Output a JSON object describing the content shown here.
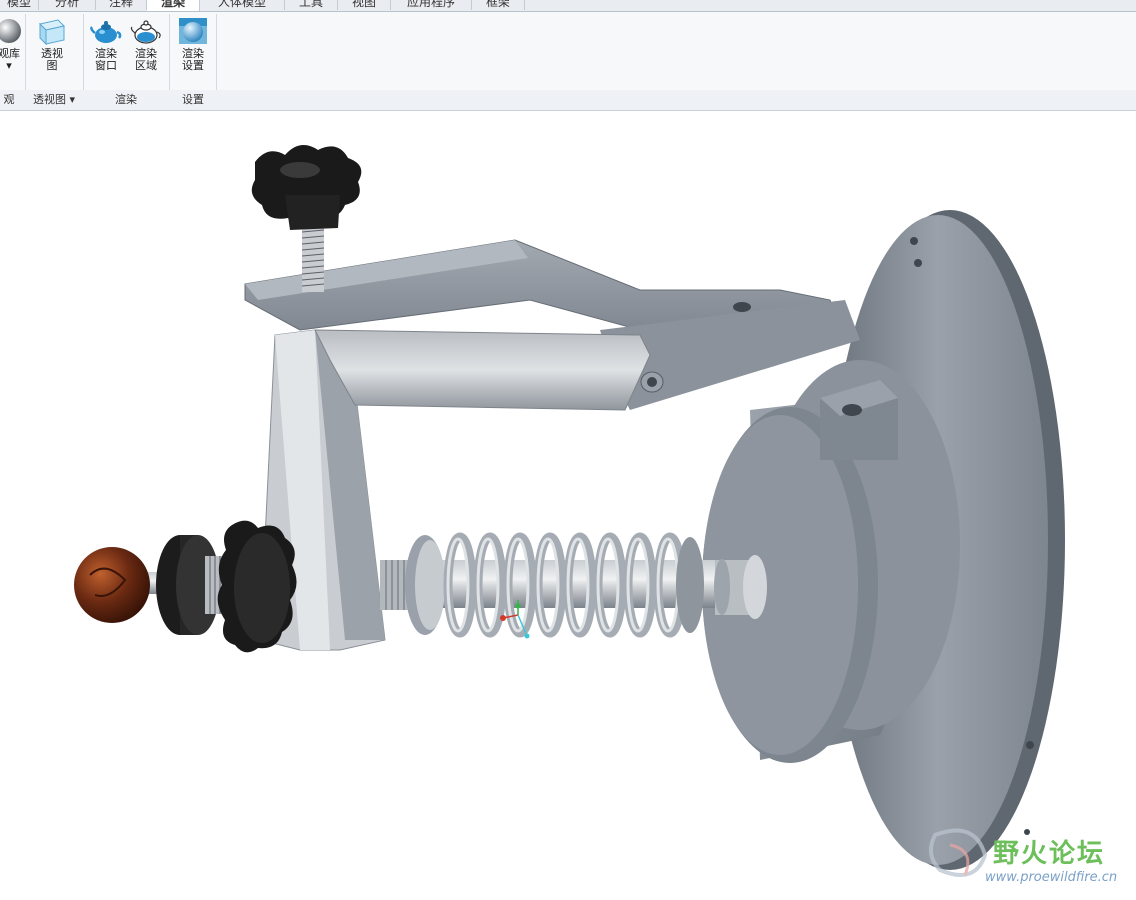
{
  "tabs": [
    {
      "label": "模型",
      "active": false
    },
    {
      "label": "分析",
      "active": false
    },
    {
      "label": "注释",
      "active": false
    },
    {
      "label": "渲染",
      "active": true
    },
    {
      "label": "人体模型",
      "active": false
    },
    {
      "label": "工具",
      "active": false
    },
    {
      "label": "视图",
      "active": false
    },
    {
      "label": "应用程序",
      "active": false
    },
    {
      "label": "框架",
      "active": false
    }
  ],
  "ribbon": {
    "buttons": [
      {
        "label_line1": "观库",
        "label_line2": "▾",
        "icon": "sphere-icon"
      },
      {
        "label_line1": "透视",
        "label_line2": "图",
        "icon": "perspective-box-icon"
      },
      {
        "label_line1": "渲染",
        "label_line2": "窗口",
        "icon": "teapot-icon"
      },
      {
        "label_line1": "渲染",
        "label_line2": "区域",
        "icon": "teapot-outline-icon"
      },
      {
        "label_line1": "渲染",
        "label_line2": "设置",
        "icon": "render-settings-icon"
      }
    ],
    "groups": [
      {
        "label": "观"
      },
      {
        "label": "透视图 ▾"
      },
      {
        "label": "渲染"
      },
      {
        "label": "设置"
      }
    ]
  },
  "watermark": {
    "text": "野火论坛",
    "url": "www.proewildfire.cn"
  },
  "colors": {
    "part_gray": "#8a929c",
    "part_dark": "#5e6670",
    "knob_black": "#1a1a1a",
    "ball_brown": "#6b2a12"
  }
}
